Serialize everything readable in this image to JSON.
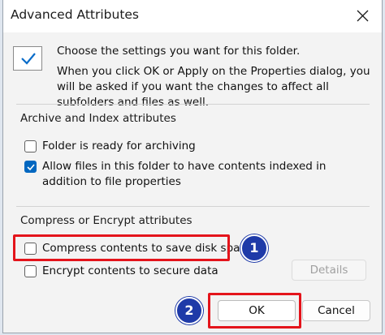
{
  "dialog": {
    "title": "Advanced Attributes",
    "intro_line1": "Choose the settings you want for this folder.",
    "intro_line2": "When you click OK or Apply on the Properties dialog, you will be asked if you want the changes to affect all subfolders and files as well."
  },
  "archive_group": {
    "label": "Archive and Index attributes",
    "ready_for_archiving": {
      "label": "Folder is ready for archiving",
      "checked": false
    },
    "allow_indexing": {
      "label": "Allow files in this folder to have contents indexed in addition to file properties",
      "checked": true
    }
  },
  "compress_group": {
    "label": "Compress or Encrypt attributes",
    "compress": {
      "label": "Compress contents to save disk space",
      "checked": false
    },
    "encrypt": {
      "label": "Encrypt contents to secure data",
      "checked": false
    },
    "details_label": "Details"
  },
  "buttons": {
    "ok": "OK",
    "cancel": "Cancel"
  },
  "annotations": {
    "marker1": "1",
    "marker2": "2",
    "highlight_color": "#e4141b",
    "marker_color": "#1e3aa8"
  }
}
